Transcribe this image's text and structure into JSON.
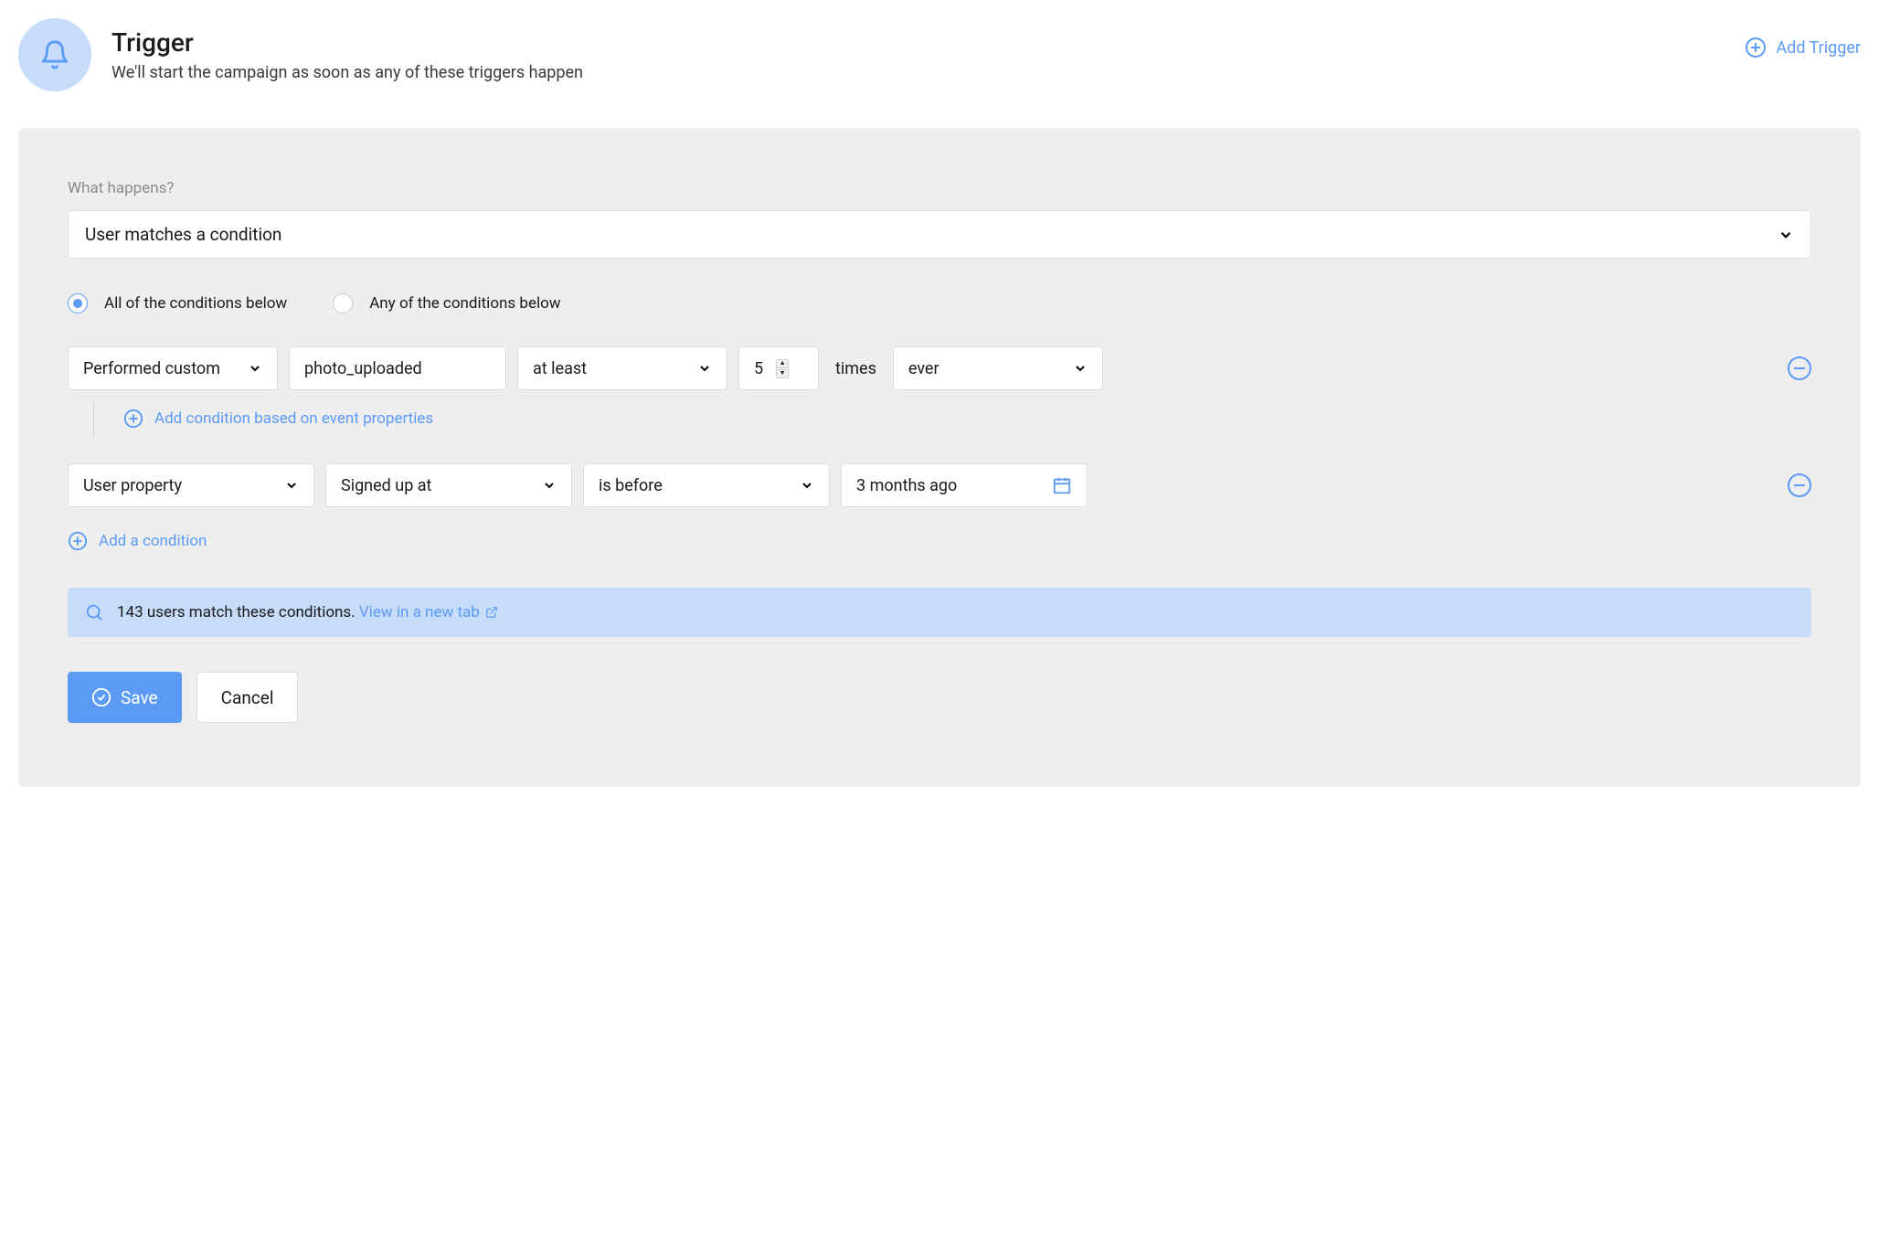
{
  "header": {
    "title": "Trigger",
    "subtitle": "We'll start the campaign as soon as any of these triggers happen",
    "add_trigger_label": "Add Trigger"
  },
  "form": {
    "what_happens_label": "What happens?",
    "what_happens_value": "User matches a condition",
    "radio_all_label": "All of the conditions below",
    "radio_any_label": "Any of the conditions below",
    "radio_selected": "all",
    "condition1": {
      "type": "Performed custom",
      "event": "photo_uploaded",
      "comparator": "at least",
      "count": "5",
      "times_label": "times",
      "when": "ever",
      "sub_add_label": "Add condition based on event properties"
    },
    "condition2": {
      "type": "User property",
      "property": "Signed up at",
      "operator": "is before",
      "value": "3 months ago"
    },
    "add_condition_label": "Add a condition",
    "match_text": "143 users match these conditions.",
    "view_link": "View in a new tab",
    "save_label": "Save",
    "cancel_label": "Cancel"
  }
}
